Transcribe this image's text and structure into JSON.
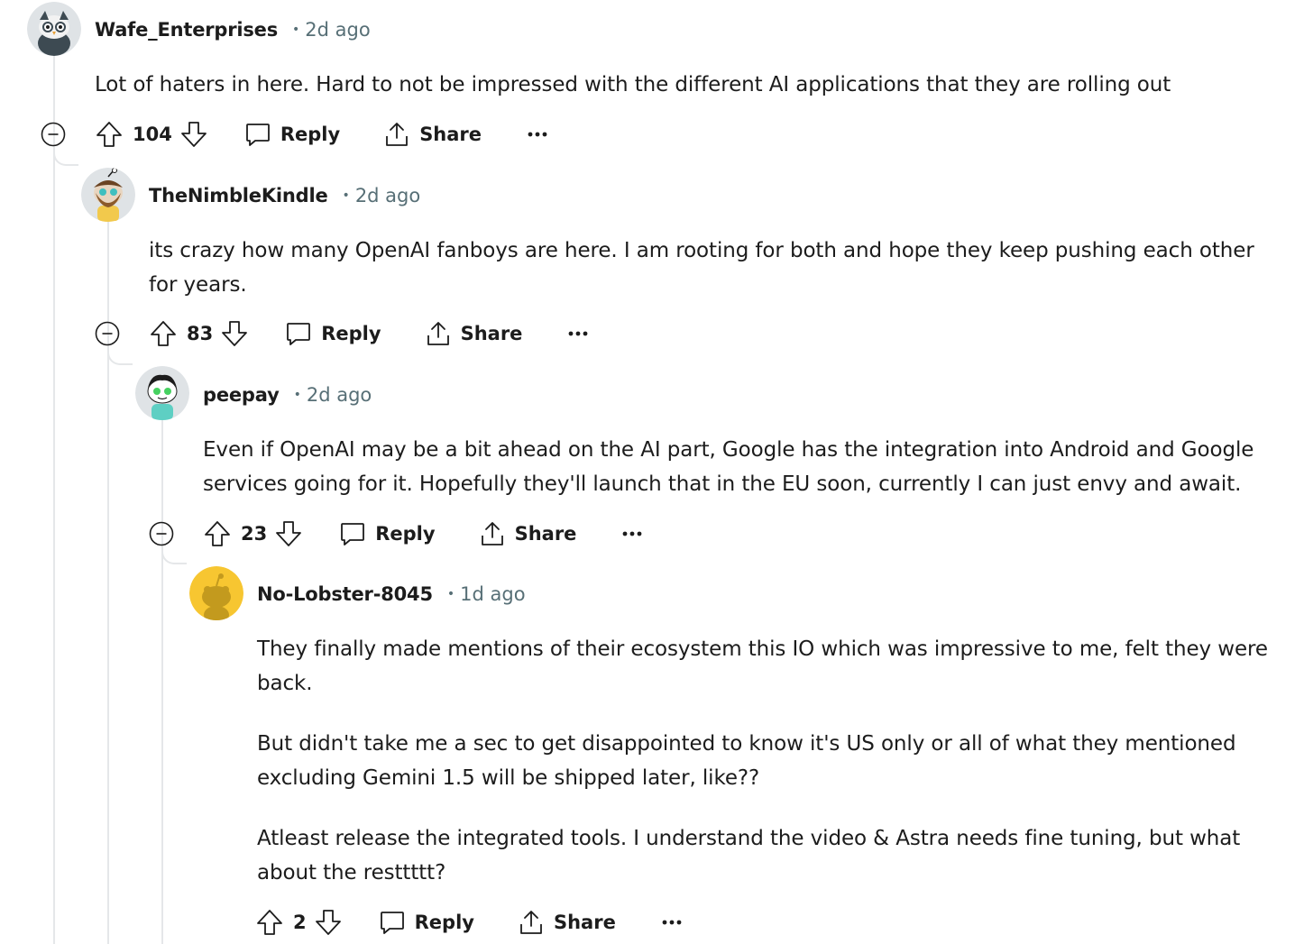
{
  "comments": [
    {
      "username": "Wafe_Enterprises",
      "separator": "•",
      "time": "2d ago",
      "avatar": "snoo-owl-avatar",
      "body": [
        "Lot of haters in here. Hard to not be impressed with the different AI applications that they are rolling out"
      ],
      "score": "104",
      "reply_label": "Reply",
      "share_label": "Share",
      "collapsible": true
    },
    {
      "username": "TheNimbleKindle",
      "separator": "•",
      "time": "2d ago",
      "avatar": "snoo-bearded-avatar",
      "body": [
        "its crazy how many OpenAI fanboys are here. I am rooting for both and hope they keep pushing each other for years."
      ],
      "score": "83",
      "reply_label": "Reply",
      "share_label": "Share",
      "collapsible": true
    },
    {
      "username": "peepay",
      "separator": "•",
      "time": "2d ago",
      "avatar": "snoo-green-eyes-avatar",
      "body": [
        "Even if OpenAI may be a bit ahead on the AI part, Google has the integration into Android and Google services going for it. Hopefully they'll launch that in the EU soon, currently I can just envy and await."
      ],
      "score": "23",
      "reply_label": "Reply",
      "share_label": "Share",
      "collapsible": true
    },
    {
      "username": "No-Lobster-8045",
      "separator": "•",
      "time": "1d ago",
      "avatar": "snoo-default-yellow-avatar",
      "body": [
        "They finally made mentions of their ecosystem this IO which was impressive to me, felt they were back.",
        "But didn't take me a sec to get disappointed to know it's US only or all of what they mentioned excluding Gemini 1.5 will be shipped later, like??",
        "Atleast release the integrated tools. I understand the video & Astra needs fine tuning, but what about the resttttt?"
      ],
      "score": "2",
      "reply_label": "Reply",
      "share_label": "Share",
      "collapsible": false
    }
  ],
  "icons": {
    "collapse": "minus-circle-icon",
    "upvote": "arrow-up-icon",
    "downvote": "arrow-down-icon",
    "reply": "speech-bubble-icon",
    "share": "share-upload-icon",
    "more": "ellipsis-icon"
  },
  "colors": {
    "text": "#1c1c1c",
    "meta": "#576f76",
    "thread_line": "#e5e7e9",
    "default_avatar": "#f7c631"
  }
}
